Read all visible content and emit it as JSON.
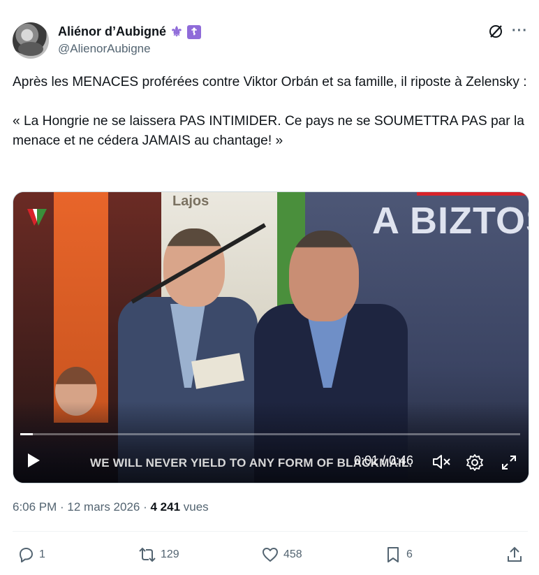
{
  "author": {
    "name": "Aliénor d’Aubigné",
    "badges": [
      "fleur-de-lis-icon",
      "orthodox-cross-icon"
    ],
    "handle": "@AlienorAubigne"
  },
  "tweet": {
    "text": "Après les MENACES proférées contre Viktor Orbán et sa famille, il riposte à Zelensky :\n\n« La Hongrie ne se laissera PAS INTIMIDER. Ce pays ne se SOUMETTRA PAS par la menace et ne cédera JAMAIS au chantage! »"
  },
  "video": {
    "poster_text": "Lajos",
    "wall_text": "A BIZTOS",
    "subtitle": "WE WILL NEVER YIELD TO ANY FORM OF BLACKMAIL.",
    "time": "0:01 / 0:46",
    "progress": 0.025
  },
  "meta": {
    "time": "6:06 PM",
    "separator1": " · ",
    "date": "12 mars 2026",
    "separator2": " · ",
    "views_count": "4 241",
    "views_label": " vues"
  },
  "actions": {
    "replies": "1",
    "reposts": "129",
    "likes": "458",
    "bookmarks": "6"
  },
  "colors": {
    "text": "#0f1419",
    "secondary": "#536471",
    "badge": "#8f6bd9"
  }
}
